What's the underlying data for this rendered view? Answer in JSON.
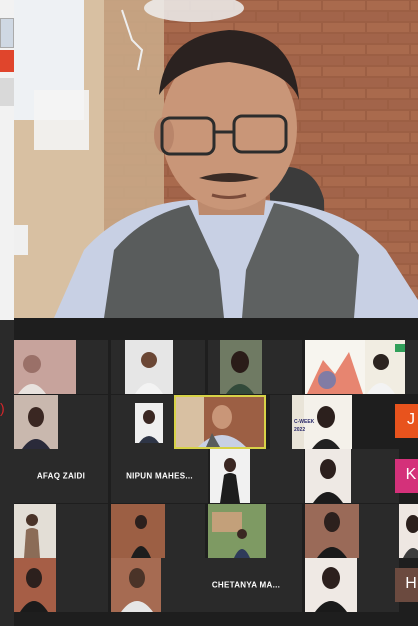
{
  "gallery": {
    "labels": {
      "afaq": "AFAQ ZAIDI",
      "nipun": "NIPUN MAHES...",
      "chetanya": "CHETANYA MA..."
    },
    "initials": {
      "j": "J",
      "k": "K",
      "h": "H"
    },
    "poster": {
      "year": "2022",
      "week": "C-WEEK"
    }
  },
  "left_panel": {
    "paren": ")"
  },
  "colors": {
    "active_border": "#d7d247",
    "initial_orange": "#e8531d",
    "initial_pink": "#d4317a",
    "initial_brown": "#6b4a3f",
    "gallery_bg": "#1e1e1e",
    "tile_bg": "#2a2a2a"
  }
}
